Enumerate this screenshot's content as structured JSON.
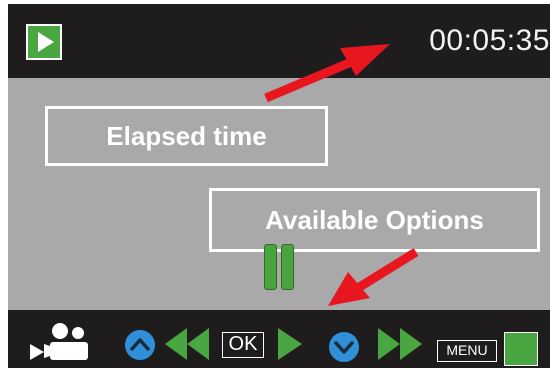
{
  "header": {
    "mode_icon": "play-icon",
    "elapsed_time": "00:05:35"
  },
  "annotations": {
    "elapsed_label": "Elapsed time",
    "options_label": "Available Options"
  },
  "status": {
    "state_icon": "pause-icon"
  },
  "controls": {
    "video_mode_icon": "video-camera-icon",
    "up_icon": "up-circle-icon",
    "rewind_icon": "rewind-icon",
    "ok_label": "OK",
    "play_icon": "play-icon",
    "down_icon": "down-circle-icon",
    "fast_forward_icon": "fast-forward-icon",
    "menu_label": "MENU",
    "status_square_icon": "green-square-icon"
  },
  "colors": {
    "accent_green": "#49a640",
    "accent_blue": "#2f8fd8",
    "arrow_red": "#e8171f",
    "viewport_gray": "#a9a9a9",
    "bar_black": "#1e1c1d"
  }
}
